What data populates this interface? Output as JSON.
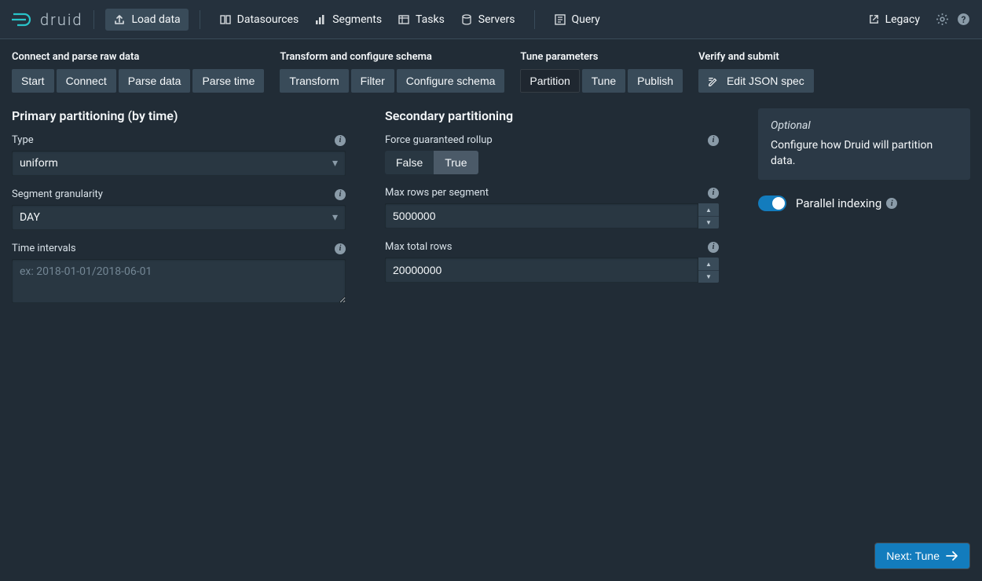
{
  "brand": "druid",
  "nav": {
    "load_data": "Load data",
    "datasources": "Datasources",
    "segments": "Segments",
    "tasks": "Tasks",
    "servers": "Servers",
    "query": "Query",
    "legacy": "Legacy"
  },
  "step_groups": {
    "connect": {
      "label": "Connect and parse raw data",
      "items": [
        "Start",
        "Connect",
        "Parse data",
        "Parse time"
      ]
    },
    "transform": {
      "label": "Transform and configure schema",
      "items": [
        "Transform",
        "Filter",
        "Configure schema"
      ]
    },
    "tune": {
      "label": "Tune parameters",
      "items": [
        "Partition",
        "Tune",
        "Publish"
      ]
    },
    "verify": {
      "label": "Verify and submit",
      "edit_json": "Edit JSON spec"
    }
  },
  "primary": {
    "heading": "Primary partitioning (by time)",
    "type_label": "Type",
    "type_value": "uniform",
    "gran_label": "Segment granularity",
    "gran_value": "DAY",
    "intervals_label": "Time intervals",
    "intervals_placeholder": "ex: 2018-01-01/2018-06-01"
  },
  "secondary": {
    "heading": "Secondary partitioning",
    "rollup_label": "Force guaranteed rollup",
    "rollup_false": "False",
    "rollup_true": "True",
    "max_rows_seg_label": "Max rows per segment",
    "max_rows_seg_value": "5000000",
    "max_total_label": "Max total rows",
    "max_total_value": "20000000"
  },
  "side": {
    "optional": "Optional",
    "desc": "Configure how Druid will partition data.",
    "parallel": "Parallel indexing"
  },
  "next_label": "Next: Tune"
}
